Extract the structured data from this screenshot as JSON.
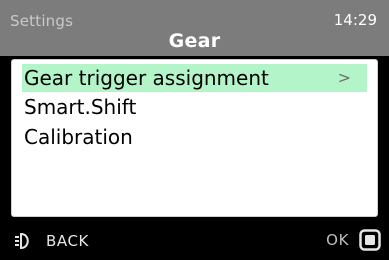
{
  "header": {
    "section": "Settings",
    "time": "14:29",
    "title": "Gear"
  },
  "menu": {
    "items": [
      {
        "label": "Gear trigger assignment",
        "selected": true,
        "chevron": ">"
      },
      {
        "label": "Smart.Shift",
        "selected": false
      },
      {
        "label": "Calibration",
        "selected": false
      }
    ]
  },
  "footer": {
    "back_label": "BACK",
    "back_icon": "headlight-icon",
    "ok_label": "OK",
    "ok_icon": "square-button-icon"
  },
  "colors": {
    "header_bg": "#7c7c7c",
    "selection_highlight": "#b3f5c8",
    "panel_bg": "#ffffff",
    "footer_bg": "#000000"
  }
}
